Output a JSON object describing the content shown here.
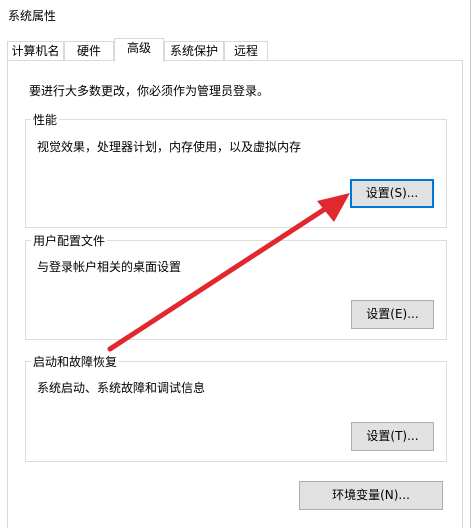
{
  "window": {
    "title": "系统属性"
  },
  "tabs": [
    {
      "label": "计算机名"
    },
    {
      "label": "硬件"
    },
    {
      "label": "高级"
    },
    {
      "label": "系统保护"
    },
    {
      "label": "远程"
    }
  ],
  "active_tab": "高级",
  "admin_note": "要进行大多数更改，你必须作为管理员登录。",
  "groups": {
    "performance": {
      "title": "性能",
      "description": "视觉效果，处理器计划，内存使用，以及虚拟内存",
      "button": "设置(S)..."
    },
    "user_profiles": {
      "title": "用户配置文件",
      "description": "与登录帐户相关的桌面设置",
      "button": "设置(E)..."
    },
    "startup_recovery": {
      "title": "启动和故障恢复",
      "description": "系统启动、系统故障和调试信息",
      "button": "设置(T)..."
    }
  },
  "env_vars_button": "环境变量(N)...",
  "annotation": {
    "arrow_color": "#e0282e"
  },
  "colors": {
    "focus_border": "#0078d7",
    "button_face": "#e1e1e1"
  }
}
